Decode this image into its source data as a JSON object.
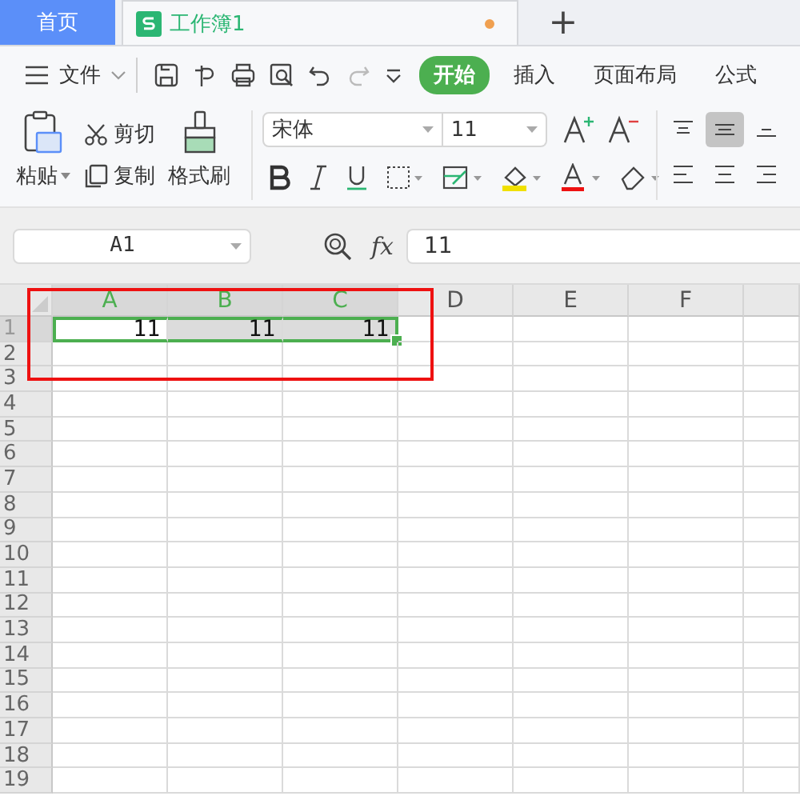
{
  "tabs": [
    {
      "label": "首页",
      "kind": "home",
      "selected": false
    },
    {
      "label": "工作簿1",
      "kind": "sheet",
      "selected": true,
      "modified": true
    }
  ],
  "new_tab": "+",
  "menu": {
    "file": "文件",
    "ribbon_tabs": [
      {
        "label": "开始",
        "selected": true
      },
      {
        "label": "插入",
        "selected": false
      },
      {
        "label": "页面布局",
        "selected": false
      },
      {
        "label": "公式",
        "selected": false
      }
    ]
  },
  "ribbon": {
    "paste": "粘贴",
    "cut": "剪切",
    "copy": "复制",
    "format_painter": "格式刷",
    "font": "宋体",
    "font_size": "11",
    "align_center_selected": true
  },
  "formula_bar": {
    "name_box": "A1",
    "fx": "fx",
    "value": "11"
  },
  "grid": {
    "columns": [
      {
        "label": "A",
        "selected": true
      },
      {
        "label": "B",
        "selected": true
      },
      {
        "label": "C",
        "selected": true
      },
      {
        "label": "D",
        "selected": false
      },
      {
        "label": "E",
        "selected": false
      },
      {
        "label": "F",
        "selected": false
      }
    ],
    "rows": [
      {
        "label": "1",
        "selected": true,
        "cells": [
          {
            "value": "11",
            "selected": true,
            "active": true
          },
          {
            "value": "11",
            "selected": true,
            "active": false
          },
          {
            "value": "11",
            "selected": true,
            "active": false
          }
        ]
      },
      {
        "label": "2",
        "selected": false
      },
      {
        "label": "3",
        "selected": false
      },
      {
        "label": "4",
        "selected": false
      },
      {
        "label": "5",
        "selected": false
      },
      {
        "label": "6",
        "selected": false
      },
      {
        "label": "7",
        "selected": false
      },
      {
        "label": "8",
        "selected": false
      },
      {
        "label": "9",
        "selected": false
      },
      {
        "label": "10",
        "selected": false
      },
      {
        "label": "11",
        "selected": false
      },
      {
        "label": "12",
        "selected": false
      },
      {
        "label": "13",
        "selected": false
      },
      {
        "label": "14",
        "selected": false
      },
      {
        "label": "15",
        "selected": false
      },
      {
        "label": "16",
        "selected": false
      },
      {
        "label": "17",
        "selected": false
      },
      {
        "label": "18",
        "selected": false
      },
      {
        "label": "19",
        "selected": false
      }
    ]
  }
}
